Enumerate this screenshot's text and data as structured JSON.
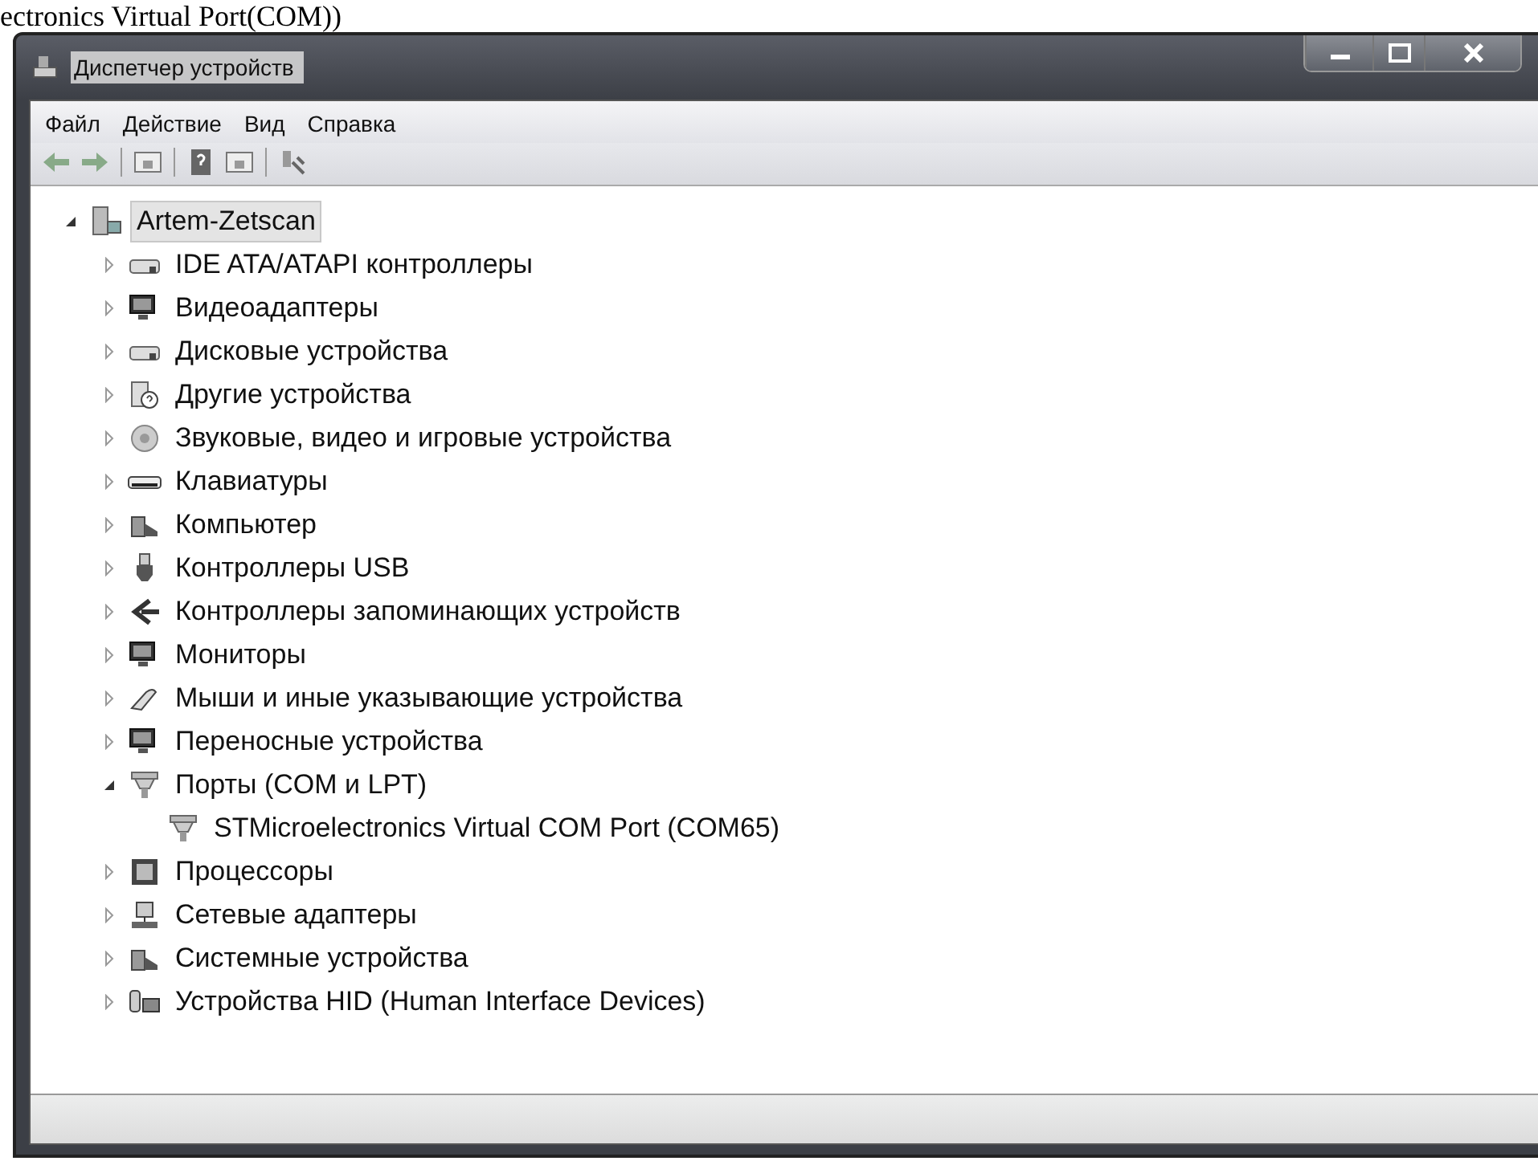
{
  "caption": "ectronics Virtual Port(COM))",
  "window": {
    "title": "Диспетчер устройств"
  },
  "menu": [
    {
      "label": "Файл"
    },
    {
      "label": "Действие"
    },
    {
      "label": "Вид"
    },
    {
      "label": "Справка"
    }
  ],
  "toolbar": [
    {
      "kind": "back"
    },
    {
      "kind": "forward"
    },
    {
      "kind": "sep"
    },
    {
      "kind": "pane"
    },
    {
      "kind": "sep"
    },
    {
      "kind": "help"
    },
    {
      "kind": "pane"
    },
    {
      "kind": "sep"
    },
    {
      "kind": "scan"
    }
  ],
  "tree": [
    {
      "label": "Artem-Zetscan",
      "kind": "computer",
      "selected": true,
      "expanded": true,
      "children": [
        {
          "label": "IDE ATA/ATAPI контроллеры",
          "kind": "drive",
          "selected": false,
          "expanded": false
        },
        {
          "label": "Видеоадаптеры",
          "kind": "display",
          "selected": false,
          "expanded": false
        },
        {
          "label": "Дисковые устройства",
          "kind": "drive",
          "selected": false,
          "expanded": false
        },
        {
          "label": "Другие устройства",
          "kind": "unknown",
          "selected": false,
          "expanded": false
        },
        {
          "label": "Звуковые, видео и игровые устройства",
          "kind": "sound",
          "selected": false,
          "expanded": false
        },
        {
          "label": "Клавиатуры",
          "kind": "keyboard",
          "selected": false,
          "expanded": false
        },
        {
          "label": "Компьютер",
          "kind": "system",
          "selected": false,
          "expanded": false
        },
        {
          "label": "Контроллеры USB",
          "kind": "usb",
          "selected": false,
          "expanded": false
        },
        {
          "label": "Контроллеры запоминающих устройств",
          "kind": "storage",
          "selected": false,
          "expanded": false
        },
        {
          "label": "Мониторы",
          "kind": "display",
          "selected": false,
          "expanded": false
        },
        {
          "label": "Мыши и иные указывающие устройства",
          "kind": "mouse",
          "selected": false,
          "expanded": false
        },
        {
          "label": "Переносные устройства",
          "kind": "display",
          "selected": false,
          "expanded": false
        },
        {
          "label": "Порты (COM и LPT)",
          "kind": "port",
          "selected": false,
          "expanded": true,
          "children": [
            {
              "label": "STMicroelectronics Virtual COM Port (COM65)",
              "kind": "port",
              "selected": false
            }
          ]
        },
        {
          "label": "Процессоры",
          "kind": "cpu",
          "selected": false,
          "expanded": false
        },
        {
          "label": "Сетевые адаптеры",
          "kind": "network",
          "selected": false,
          "expanded": false
        },
        {
          "label": "Системные устройства",
          "kind": "system",
          "selected": false,
          "expanded": false
        },
        {
          "label": "Устройства HID (Human Interface Devices)",
          "kind": "hid",
          "selected": false,
          "expanded": false
        }
      ]
    }
  ]
}
